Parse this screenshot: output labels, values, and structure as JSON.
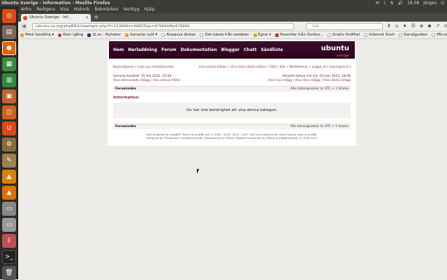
{
  "system": {
    "window_title": "Ubuntu Sverige - Information - Mozilla Firefox",
    "clock": "18.08",
    "user": "Jörgen"
  },
  "menubar": [
    "Arkiv",
    "Redigera",
    "Visa",
    "Historik",
    "Bokmärken",
    "Verktyg",
    "Hjälp"
  ],
  "tab": {
    "title": "Ubuntu Sverige - Inf..."
  },
  "urlbar": {
    "value": "ubuntu-se.org/phpBB3/viewtopic.php?f=22384&t=49825&p=479944#p479944"
  },
  "searchbar": {
    "placeholder": "Sök"
  },
  "bookmarks": [
    "Mest besökta ▾",
    "Kom igång",
    "di.se - Nyheter",
    "Senaste nytt ▾",
    "Anpassa länkar",
    "Det bästa från webben",
    "Egna ▾",
    "Favoriter från Outloo...",
    "Gratis HotMail",
    "Internet Start",
    "Kanalguiden",
    "Microsoft"
  ],
  "forum": {
    "nav": [
      "Hem",
      "Nerladdning",
      "Forum",
      "Dokumentation",
      "Bloggar",
      "Chatt",
      "Sändlista"
    ],
    "logo": "ubuntu",
    "logo_sub": "sverige",
    "control_panel": "Kontrollpanel • Inga nya meddelanden",
    "top_links": "Visa olästa trådar • Visa dina olästa trådar • FAQ • Sök • Medlemmar • Logga ut [ krassegrand ]",
    "last_visit": "Senaste besöket: 25 feb 2015, 19:56",
    "left_links": "Visa obesvarade inlägg | Visa aktiva trådar",
    "current_time": "Aktuellt datum och tid: 19 mar 2015, 18:08",
    "right_links": "Visa nya inlägg | Visa dina inlägg | Visa olästa inlägg",
    "forum_index": "Forumindex",
    "timezone": "Alla tidsangivelser är UTC + 1 timme",
    "info_heading": "Information",
    "info_message": "Du har inte behörighet att visa denna kategori.",
    "footer_line1": "Main Engined for phpBB®: Berlin at phpBB.com © 2000 - 2002, 2005 - 2007, the Group behind the Open Source code of phpBB.",
    "footer_line2": "Designed by STSoftware, modified by Kath, Konservbunk & Pestra. Swedish translation by Pestra & phpBB Sweden © 2006-2011"
  }
}
